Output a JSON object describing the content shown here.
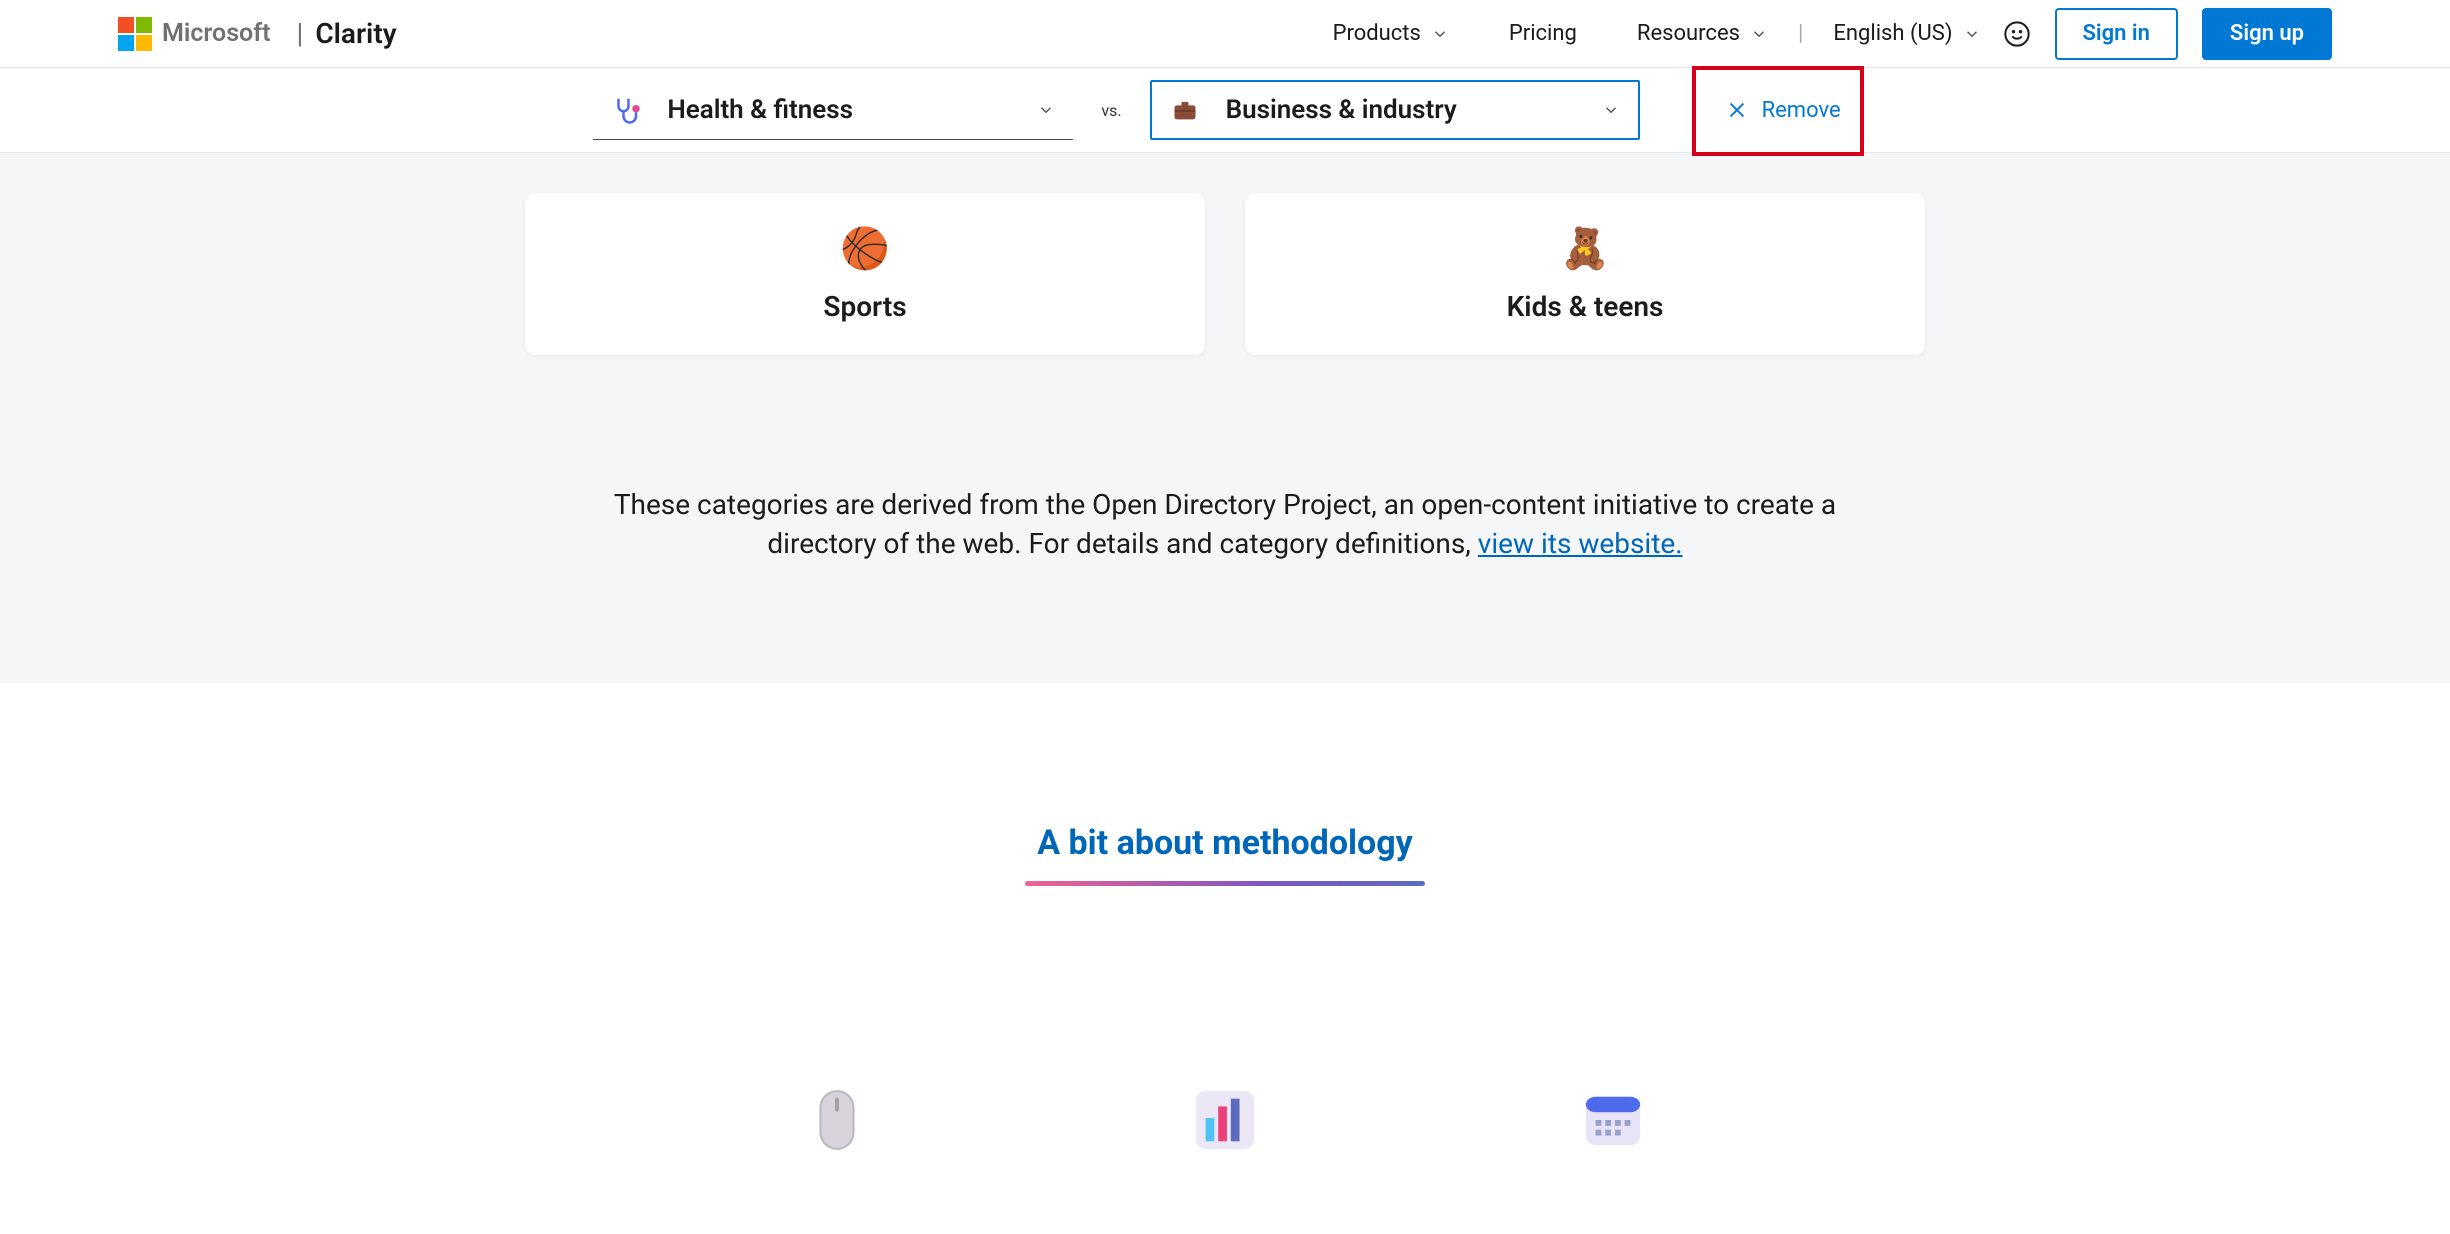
{
  "header": {
    "microsoft": "Microsoft",
    "product": "Clarity",
    "nav": {
      "products": "Products",
      "pricing": "Pricing",
      "resources": "Resources"
    },
    "language": "English (US)",
    "signin": "Sign in",
    "signup": "Sign up"
  },
  "compare": {
    "left_label": "Health & fitness",
    "vs": "vs.",
    "right_label": "Business & industry",
    "remove": "Remove"
  },
  "cards": {
    "sports": "Sports",
    "kids": "Kids & teens"
  },
  "description": {
    "text_a": "These categories are derived from the Open Directory Project, an open-content initiative to create a directory of the web. For details and category definitions, ",
    "link": "view its website."
  },
  "methodology": {
    "title": "A bit about methodology"
  }
}
